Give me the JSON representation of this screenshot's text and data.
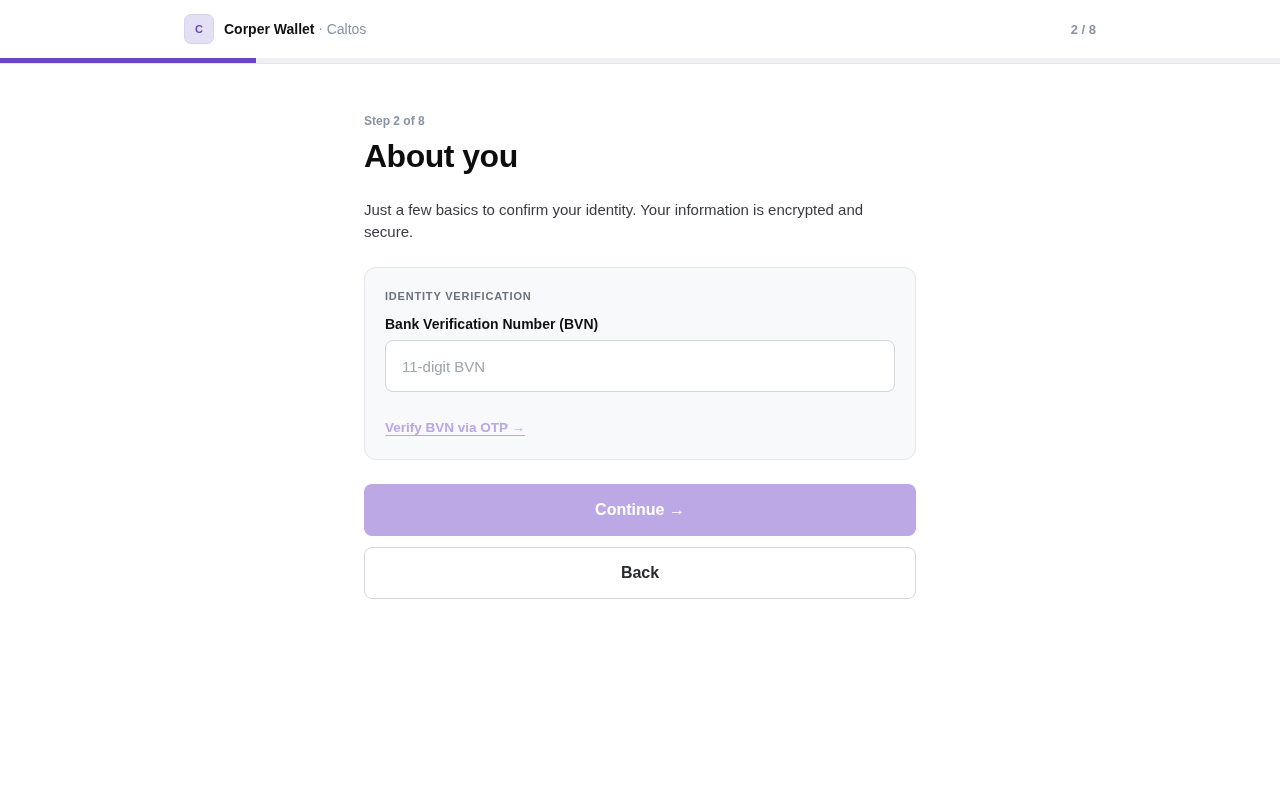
{
  "header": {
    "logo_letter": "C",
    "brand": "Corper Wallet",
    "separator": "·",
    "org": "Caltos",
    "step_counter": "2 / 8"
  },
  "progress": {
    "level": 0.2
  },
  "step_label": "Step 2 of 8",
  "title": "About you",
  "intro": "Just a few basics to confirm your identity. Your information is encrypted and secure.",
  "card": {
    "section_title": "IDENTITY VERIFICATION",
    "field": {
      "label": "Bank Verification Number (BVN)",
      "placeholder": "11-digit BVN"
    },
    "link": {
      "label": "Verify BVN via OTP →",
      "disabled": true
    }
  },
  "buttons": [
    {
      "label": "Continue →",
      "kind": "primary",
      "disabled": true
    },
    {
      "label": "Back",
      "kind": "secondary",
      "disabled": false
    }
  ]
}
